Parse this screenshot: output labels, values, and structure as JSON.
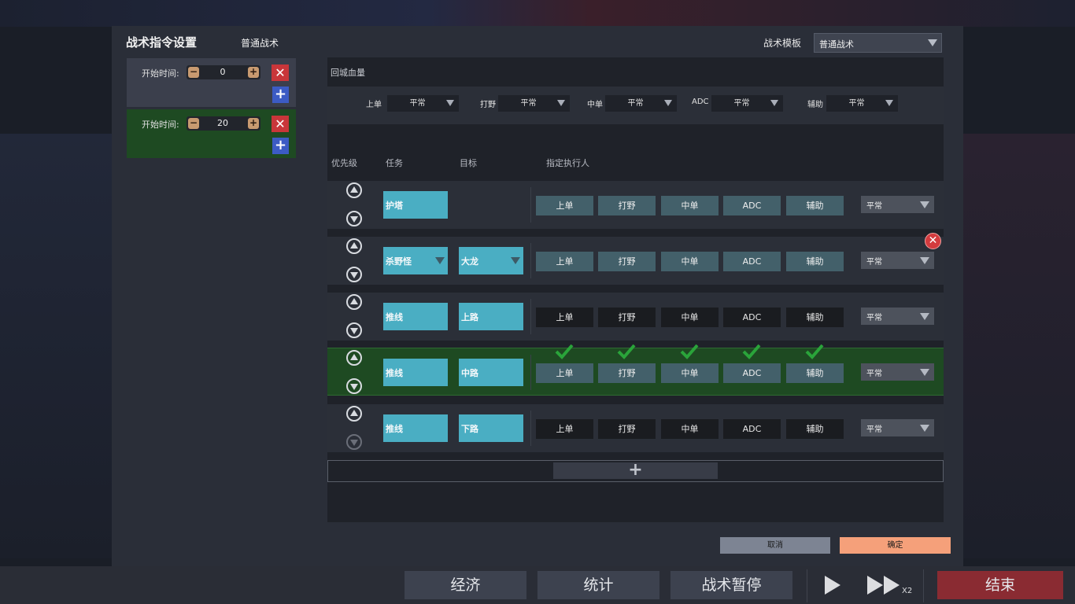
{
  "dialog": {
    "title": "战术指令设置",
    "subtitle": "普通战术",
    "template_label": "战术模板",
    "template_value": "普通战术"
  },
  "phases": [
    {
      "label": "开始时间:",
      "value": "0",
      "selected": false
    },
    {
      "label": "开始时间:",
      "value": "20",
      "selected": true
    }
  ],
  "hp_section": {
    "title": "回城血量",
    "items": [
      {
        "role": "上单",
        "value": "平常"
      },
      {
        "role": "打野",
        "value": "平常"
      },
      {
        "role": "中单",
        "value": "平常"
      },
      {
        "role": "ADC",
        "value": "平常"
      },
      {
        "role": "辅助",
        "value": "平常"
      }
    ]
  },
  "table": {
    "headers": {
      "priority": "优先级",
      "task": "任务",
      "target": "目标",
      "assignee": "指定执行人"
    },
    "roles": [
      "上单",
      "打野",
      "中单",
      "ADC",
      "辅助"
    ],
    "rows": [
      {
        "task": "护塔",
        "target": "",
        "task_dropdown": false,
        "target_dropdown": false,
        "roles_on": [
          true,
          true,
          true,
          true,
          true
        ],
        "checked": false,
        "priority": "平常",
        "active": false
      },
      {
        "task": "杀野怪",
        "target": "大龙",
        "task_dropdown": true,
        "target_dropdown": true,
        "roles_on": [
          true,
          true,
          true,
          true,
          true
        ],
        "checked": false,
        "priority": "平常",
        "active": false
      },
      {
        "task": "推线",
        "target": "上路",
        "task_dropdown": false,
        "target_dropdown": false,
        "roles_on": [
          false,
          false,
          false,
          false,
          false
        ],
        "checked": false,
        "priority": "平常",
        "active": false
      },
      {
        "task": "推线",
        "target": "中路",
        "task_dropdown": false,
        "target_dropdown": false,
        "roles_on": [
          true,
          true,
          true,
          true,
          true
        ],
        "checked": true,
        "priority": "平常",
        "active": true
      },
      {
        "task": "推线",
        "target": "下路",
        "task_dropdown": false,
        "target_dropdown": false,
        "roles_on": [
          false,
          false,
          false,
          false,
          false
        ],
        "checked": false,
        "priority": "平常",
        "active": false
      }
    ],
    "add_row_symbol": "+"
  },
  "buttons": {
    "cancel": "取消",
    "ok": "确定"
  },
  "bottom_bar": {
    "economy": "经济",
    "stats": "统计",
    "pause": "战术暂停",
    "speed": "X2",
    "end": "结束"
  },
  "colors": {
    "task_box": "#4aaec3",
    "role_on": "#43606a",
    "active_row": "#1e4a22",
    "check": "#2aa43a",
    "cancel_button": "#7d8493",
    "ok_button": "#f5a07a",
    "end_button": "#8a2b32"
  }
}
